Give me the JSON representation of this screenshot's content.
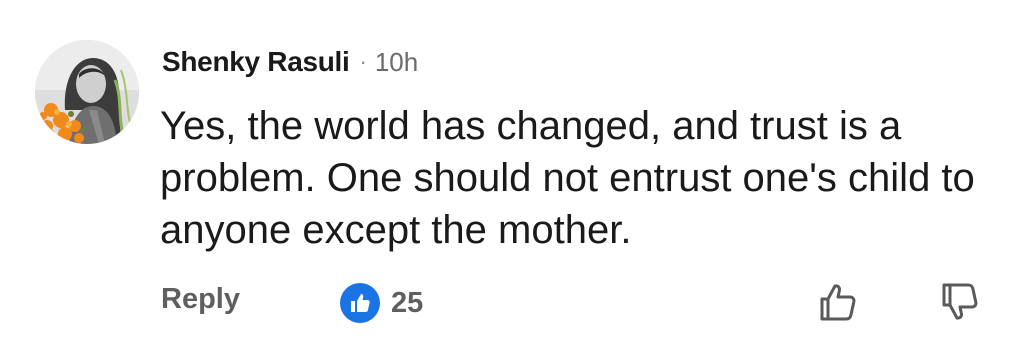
{
  "comment": {
    "author": "Shenky Rasuli",
    "separator": "·",
    "time": "10h",
    "text": "Yes, the world has changed, and trust is a problem. One should not entrust one's child to anyone except the mother.",
    "avatar_icon": "profile-photo"
  },
  "actions": {
    "reply_label": "Reply",
    "like_count": "25",
    "like_icon": "thumbs-up-icon",
    "upvote_icon": "thumbs-up-outline-icon",
    "downvote_icon": "thumbs-down-outline-icon"
  },
  "colors": {
    "like_badge": "#1b74e4",
    "action_text": "#5f5f5f",
    "body_text": "#1a1a1a"
  }
}
